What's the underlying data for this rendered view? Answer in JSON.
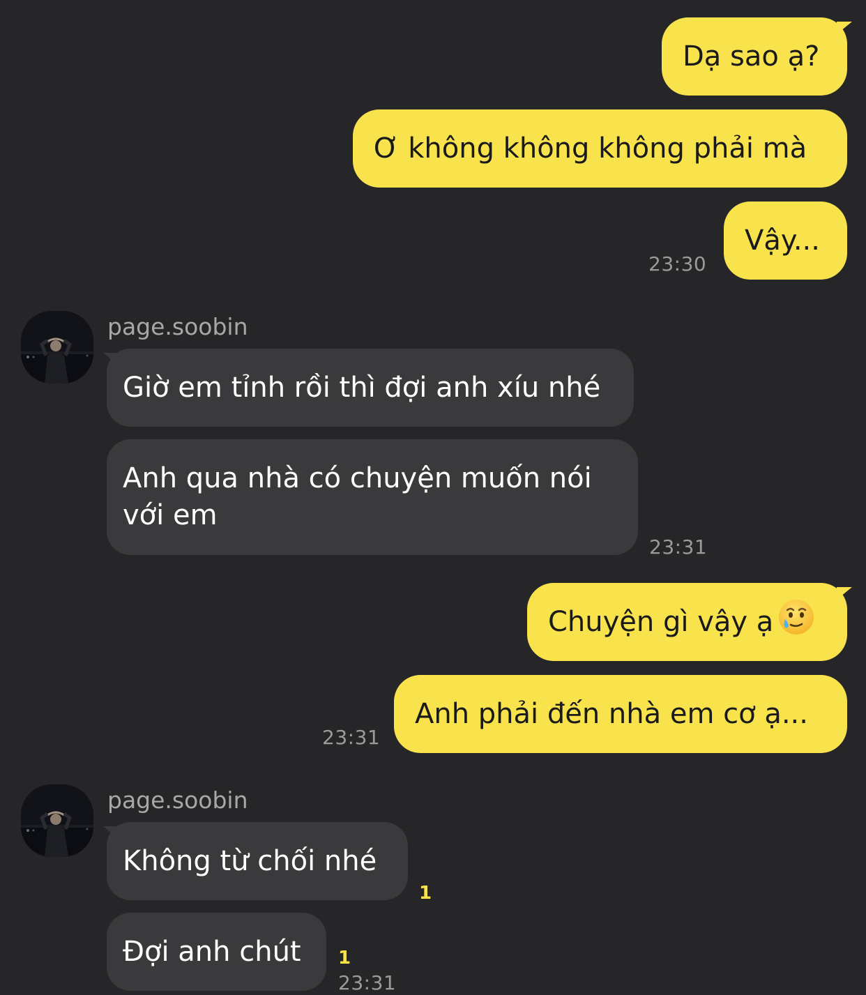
{
  "messages": {
    "m1": {
      "text": "Dạ sao ạ?"
    },
    "m2": {
      "text": "Ơ không không không phải mà"
    },
    "m3": {
      "text": "Vậy...",
      "time": "23:30"
    },
    "group1": {
      "sender": "page.soobin"
    },
    "m4": {
      "text": "Giờ em tỉnh rồi thì đợi anh xíu nhé"
    },
    "m5": {
      "text": "Anh qua nhà có chuyện muốn nói với em",
      "time": "23:31"
    },
    "m6": {
      "text": "Chuyện gì vậy ạ",
      "emoji": "crying-smile-emoji"
    },
    "m7": {
      "text": "Anh phải đến nhà em cơ ạ...",
      "time": "23:31"
    },
    "group2": {
      "sender": "page.soobin"
    },
    "m8": {
      "text": "Không từ chối nhé",
      "unread": "1"
    },
    "m9": {
      "text": "Đợi anh chút",
      "unread": "1",
      "time": "23:31"
    }
  },
  "colors": {
    "background": "#262628",
    "outgoing_bubble": "#f8e34d",
    "incoming_bubble": "#3a3a3c",
    "timestamp": "#9b9b9b",
    "unread_count": "#f8e34d"
  }
}
